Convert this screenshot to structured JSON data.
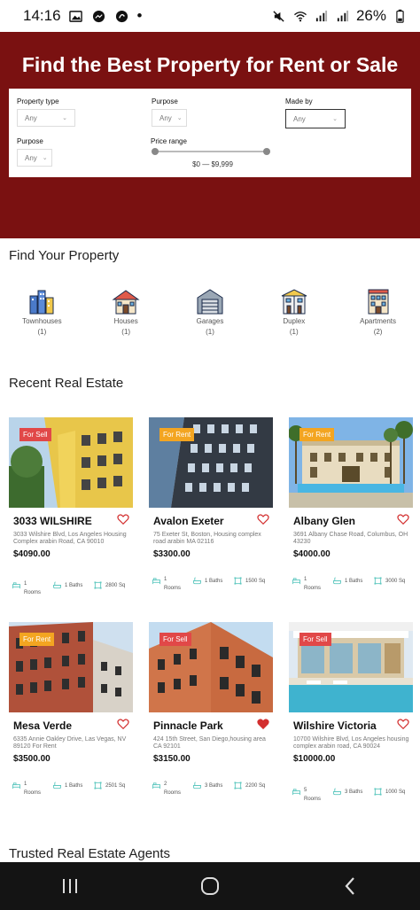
{
  "status": {
    "time": "14:16",
    "battery": "26%"
  },
  "hero": {
    "title": "Find the Best Property for Rent or Sale"
  },
  "search": {
    "property_type": {
      "label": "Property type",
      "value": "Any"
    },
    "purpose_top": {
      "label": "Purpose",
      "value": "Any"
    },
    "made_by": {
      "label": "Made by",
      "value": "Any"
    },
    "purpose": {
      "label": "Purpose",
      "value": "Any"
    },
    "price_range": {
      "label": "Price range",
      "value": "$0 — $9,999",
      "min": 0,
      "max": 9999
    }
  },
  "find": {
    "title": "Find Your Property",
    "types": [
      {
        "label": "Townhouses",
        "count": "(1)",
        "icon": "townhouse-icon"
      },
      {
        "label": "Houses",
        "count": "(1)",
        "icon": "house-icon"
      },
      {
        "label": "Garages",
        "count": "(1)",
        "icon": "garage-icon"
      },
      {
        "label": "Duplex",
        "count": "(1)",
        "icon": "duplex-icon"
      },
      {
        "label": "Apartments",
        "count": "(2)",
        "icon": "apartment-icon"
      }
    ]
  },
  "recent": {
    "title": "Recent Real Estate",
    "cards": [
      {
        "badge": "For Sell",
        "title": "3033 WILSHIRE",
        "address": "3033 Wilshire Blvd, Los Angeles Housing Complex arabin Road, CA 90010",
        "price": "$4090.00",
        "rooms": "1",
        "rooms_label": "Rooms",
        "baths": "1 Baths",
        "area": "2800 Sq",
        "favorite": false
      },
      {
        "badge": "For Rent",
        "title": "Avalon Exeter",
        "address": "75 Exeter St, Boston, Housing complex road arabin MA 02116",
        "price": "$3300.00",
        "rooms": "1",
        "rooms_label": "Rooms",
        "baths": "1 Baths",
        "area": "1500 Sq",
        "favorite": false
      },
      {
        "badge": "For Rent",
        "title": "Albany Glen",
        "address": "3691 Albany Chase Road, Columbus, OH 43230",
        "price": "$4000.00",
        "rooms": "1",
        "rooms_label": "Rooms",
        "baths": "1 Baths",
        "area": "3000 Sq",
        "favorite": false
      },
      {
        "badge": "For Rent",
        "title": "Mesa Verde",
        "address": "6335 Annie Oakley Drive, Las Vegas, NV 89120 For Rent",
        "price": "$3500.00",
        "rooms": "1",
        "rooms_label": "Rooms",
        "baths": "1 Baths",
        "area": "2501 Sq",
        "favorite": false
      },
      {
        "badge": "For Sell",
        "title": "Pinnacle Park",
        "address": "424 15th Street, San Diego,housing area CA 92101",
        "price": "$3150.00",
        "rooms": "2",
        "rooms_label": "Rooms",
        "baths": "3 Baths",
        "area": "2200 Sq",
        "favorite": true
      },
      {
        "badge": "For Sell",
        "title": "Wilshire Victoria",
        "address": "10700 Wilshire Blvd, Los Angeles housing complex arabin road, CA 90024",
        "price": "$10000.00",
        "rooms": "5",
        "rooms_label": "Rooms",
        "baths": "3 Baths",
        "area": "1000 Sq",
        "favorite": false
      }
    ]
  },
  "agents": {
    "title": "Trusted Real Estate Agents"
  },
  "colors": {
    "hero_bg": "#7a1111",
    "sell_badge": "#e14848",
    "rent_badge": "#f3a521",
    "spec_icon": "#5fc8c0",
    "heart": "#d32f2f",
    "nav_bg": "#141414"
  }
}
